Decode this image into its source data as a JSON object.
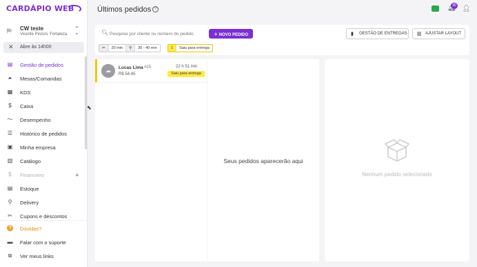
{
  "brand": {
    "logo_text": "CARDÁPIO WEB",
    "accent": "#7b2fd0"
  },
  "store": {
    "name": "CW teste",
    "address": "Vicente Pinzon, Fortaleza",
    "status": "Abre às 14h00"
  },
  "sidebar": {
    "items": [
      {
        "label": "Gestão de pedidos",
        "icon": "orders-icon",
        "glyph": "▤",
        "active": true
      },
      {
        "label": "Mesas/Comandas",
        "icon": "table-icon",
        "glyph": "⏶"
      },
      {
        "label": "KDS",
        "icon": "kds-grid-icon",
        "glyph": "▦"
      },
      {
        "label": "Caixa",
        "icon": "cash-icon",
        "glyph": "$"
      },
      {
        "label": "Desempenho",
        "icon": "chart-line-icon",
        "glyph": "〜"
      },
      {
        "label": "Histórico de pedidos",
        "icon": "history-icon",
        "glyph": "☰"
      },
      {
        "label": "Minha empresa",
        "icon": "store-icon",
        "glyph": "▣"
      },
      {
        "label": "Catálogo",
        "icon": "catalog-icon",
        "glyph": "▥"
      },
      {
        "label": "Financeiro",
        "icon": "dollar-icon",
        "glyph": "$",
        "disabled": true,
        "locked": true
      },
      {
        "label": "Estoque",
        "icon": "stock-icon",
        "glyph": "▤"
      },
      {
        "label": "Delivery",
        "icon": "bike-icon",
        "glyph": "⚲"
      },
      {
        "label": "Cupons e descontos",
        "icon": "coupon-icon",
        "glyph": "✂"
      }
    ],
    "bottom": [
      {
        "label": "Dúvidas?",
        "icon": "help-icon",
        "glyph": "?"
      },
      {
        "label": "Falar com o suporte",
        "icon": "chat-icon",
        "glyph": "▬"
      },
      {
        "label": "Ver meus links",
        "icon": "link-icon",
        "glyph": "⧉"
      }
    ]
  },
  "header": {
    "title": "Últimos pedidos",
    "notifications_count": "30"
  },
  "toolbar": {
    "search_placeholder": "Pesquise por cliente ou número do pedido",
    "new_order": "NOVO PEDIDO",
    "delivery_mgmt": "GESTÃO DE ENTREGAS",
    "adjust_layout": "AJUSTAR LAYOUT",
    "pickup_time": "20 min",
    "delivery_time": "30 - 40 min",
    "status_count": "1",
    "status_label": "Saiu para entrega"
  },
  "orders": [
    {
      "customer": "Lucas Lima",
      "number": "#25",
      "price": "R$ 54,45",
      "time": "22 h 51 min",
      "status": "Saiu para entrega"
    }
  ],
  "panels": {
    "empty_orders": "Seus pedidos aparecerão aqui",
    "no_selection": "Nenhum pedido selecionado"
  }
}
